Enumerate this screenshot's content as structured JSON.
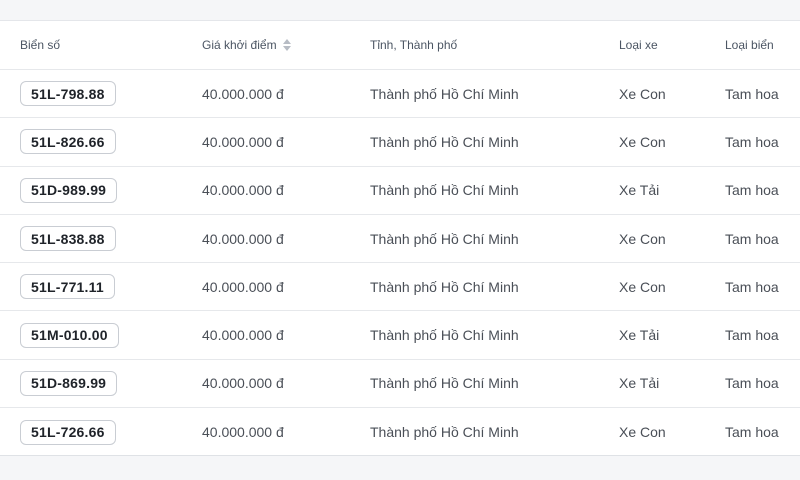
{
  "table": {
    "headers": {
      "plate": "Biển số",
      "price": "Giá khởi điểm",
      "province": "Tỉnh, Thành phố",
      "vehicle_type": "Loại xe",
      "plate_type": "Loại biển"
    },
    "sort_icon": "sort-up-down-icon",
    "rows": [
      {
        "plate": "51L-798.88",
        "price": "40.000.000 đ",
        "province": "Thành phố Hồ Chí Minh",
        "vehicle_type": "Xe Con",
        "plate_type": "Tam hoa"
      },
      {
        "plate": "51L-826.66",
        "price": "40.000.000 đ",
        "province": "Thành phố Hồ Chí Minh",
        "vehicle_type": "Xe Con",
        "plate_type": "Tam hoa"
      },
      {
        "plate": "51D-989.99",
        "price": "40.000.000 đ",
        "province": "Thành phố Hồ Chí Minh",
        "vehicle_type": "Xe Tải",
        "plate_type": "Tam hoa"
      },
      {
        "plate": "51L-838.88",
        "price": "40.000.000 đ",
        "province": "Thành phố Hồ Chí Minh",
        "vehicle_type": "Xe Con",
        "plate_type": "Tam hoa"
      },
      {
        "plate": "51L-771.11",
        "price": "40.000.000 đ",
        "province": "Thành phố Hồ Chí Minh",
        "vehicle_type": "Xe Con",
        "plate_type": "Tam hoa"
      },
      {
        "plate": "51M-010.00",
        "price": "40.000.000 đ",
        "province": "Thành phố Hồ Chí Minh",
        "vehicle_type": "Xe Tải",
        "plate_type": "Tam hoa"
      },
      {
        "plate": "51D-869.99",
        "price": "40.000.000 đ",
        "province": "Thành phố Hồ Chí Minh",
        "vehicle_type": "Xe Tải",
        "plate_type": "Tam hoa"
      },
      {
        "plate": "51L-726.66",
        "price": "40.000.000 đ",
        "province": "Thành phố Hồ Chí Minh",
        "vehicle_type": "Xe Con",
        "plate_type": "Tam hoa"
      }
    ]
  }
}
